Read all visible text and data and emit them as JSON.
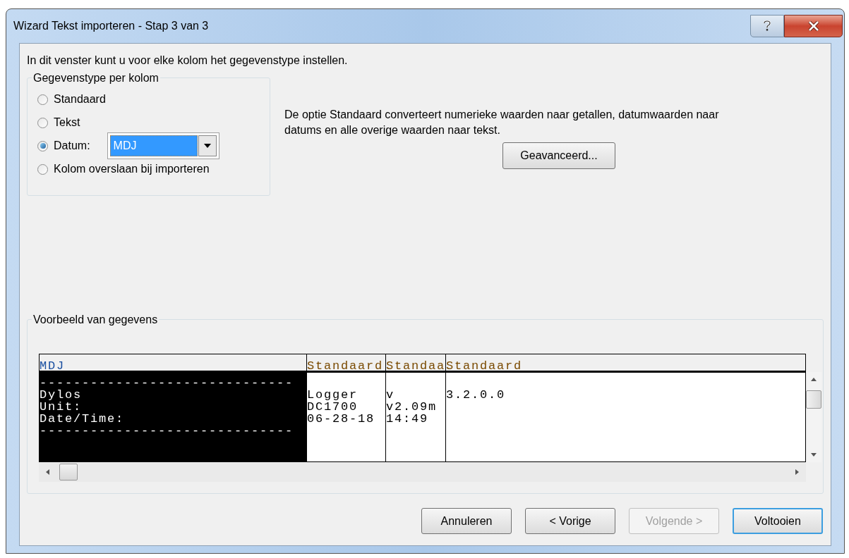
{
  "window": {
    "title": "Wizard Tekst importeren - Stap 3 van 3"
  },
  "intro": "In dit venster kunt u voor elke kolom het gegevenstype instellen.",
  "column_type_group": {
    "legend": "Gegevenstype per kolom",
    "options": [
      {
        "label": "Standaard",
        "selected": false
      },
      {
        "label": "Tekst",
        "selected": false
      },
      {
        "label": "Datum:",
        "selected": true,
        "dropdown": "MDJ"
      },
      {
        "label": "Kolom overslaan bij importeren",
        "selected": false
      }
    ]
  },
  "description": "De optie Standaard converteert numerieke waarden naar getallen, datumwaarden naar datums en alle overige waarden naar tekst.",
  "advanced_button": "Geavanceerd...",
  "preview": {
    "legend": "Voorbeeld van gegevens",
    "columns": [
      {
        "header": "MDJ",
        "selected": true,
        "cells": [
          "------------------------------",
          "Dylos",
          "Unit:",
          "Date/Time:",
          "------------------------------"
        ]
      },
      {
        "header": "Standaard",
        "selected": false,
        "cells": [
          null,
          "Logger",
          "DC1700",
          "06-28-18",
          null
        ]
      },
      {
        "header": "Standaa",
        "selected": false,
        "cells": [
          null,
          "v",
          "v2.09m",
          "14:49",
          null
        ]
      },
      {
        "header": "Standaard",
        "selected": false,
        "cells": [
          null,
          "3.2.0.0",
          null,
          null,
          null
        ]
      }
    ]
  },
  "buttons": [
    {
      "label": "Annuleren",
      "disabled": false,
      "default": false
    },
    {
      "label": "< Vorige",
      "disabled": false,
      "default": false
    },
    {
      "label": "Volgende >",
      "disabled": true,
      "default": false
    },
    {
      "label": "Voltooien",
      "disabled": false,
      "default": true
    }
  ]
}
